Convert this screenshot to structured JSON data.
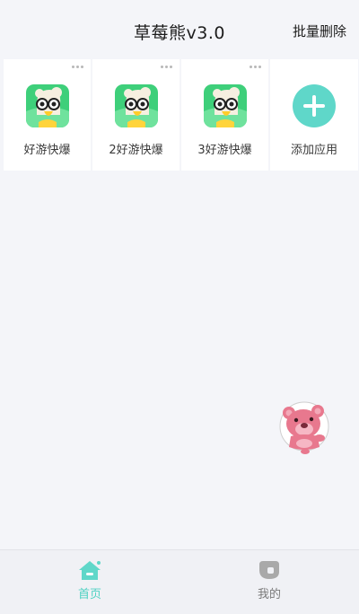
{
  "header": {
    "title": "草莓熊v3.0",
    "batch_delete": "批量删除"
  },
  "apps": [
    {
      "label": "好游快爆",
      "icon": "duck-app-icon"
    },
    {
      "label": "2好游快爆",
      "icon": "duck-app-icon"
    },
    {
      "label": "3好游快爆",
      "icon": "duck-app-icon"
    }
  ],
  "add_app": {
    "label": "添加应用",
    "icon": "plus-icon",
    "color": "#5fd7c9"
  },
  "floating": {
    "icon": "strawberry-bear-avatar"
  },
  "tabbar": {
    "home": {
      "label": "首页",
      "icon": "home-icon",
      "color": "#4ed1c2"
    },
    "mine": {
      "label": "我的",
      "icon": "profile-icon",
      "color": "#9a9a9a"
    }
  },
  "colors": {
    "accent": "#5fd7c9",
    "app_icon_bg": "#3ecf7a",
    "background": "#f4f5f9"
  }
}
